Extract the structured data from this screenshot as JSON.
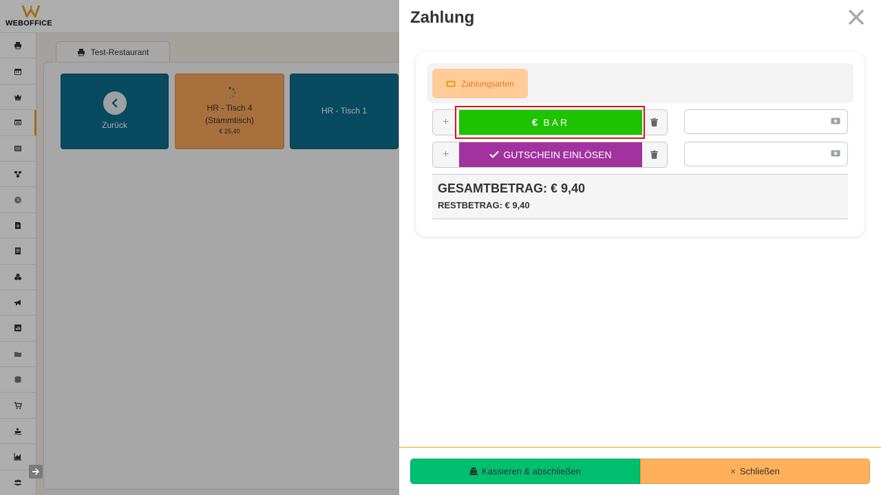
{
  "app": {
    "logo_text": "WEBOFFICE",
    "room_tab_label": "Test-Restaurant",
    "sidebar_icons": [
      "printer-icon",
      "calendar-icon",
      "crown-icon",
      "table-plan-icon",
      "list-icon",
      "network-icon",
      "clock-icon",
      "document-icon",
      "receipt-icon",
      "coins-icon",
      "megaphone-icon",
      "bar-chart-icon",
      "folder-icon",
      "database-icon",
      "cart-icon",
      "boat-icon",
      "area-chart-icon",
      "users-icon"
    ],
    "active_sidebar_index": 3,
    "tables": [
      {
        "label": "Zurück"
      },
      {
        "label_line1": "HR - Tisch 4",
        "label_line2": "(Stammtisch)",
        "price": "€ 25,40"
      },
      {
        "label": "HR - Tisch 1"
      }
    ]
  },
  "drawer": {
    "title": "Zahlung",
    "methods_label": "Zahlungsarten",
    "rows": [
      {
        "plus": "+",
        "label": "BAR",
        "currency_symbol": "€",
        "amount": "",
        "color": "#1ec300"
      },
      {
        "plus": "+",
        "label": "GUTSCHEIN EINLÖSEN",
        "amount": "",
        "color": "#a1329e"
      }
    ],
    "total": "GESAMTBETRAG: € 9,40",
    "rest": "RESTBETRAG: € 9,40",
    "checkout_label": "Kassieren & abschließen",
    "close_label": "Schließen",
    "close_x": "×"
  },
  "colors": {
    "accent": "#f0a020",
    "table_blue": "#0c6e8e",
    "table_orange": "#f7a65a",
    "checkout_green": "#00c070",
    "close_orange": "#ffb05a"
  }
}
